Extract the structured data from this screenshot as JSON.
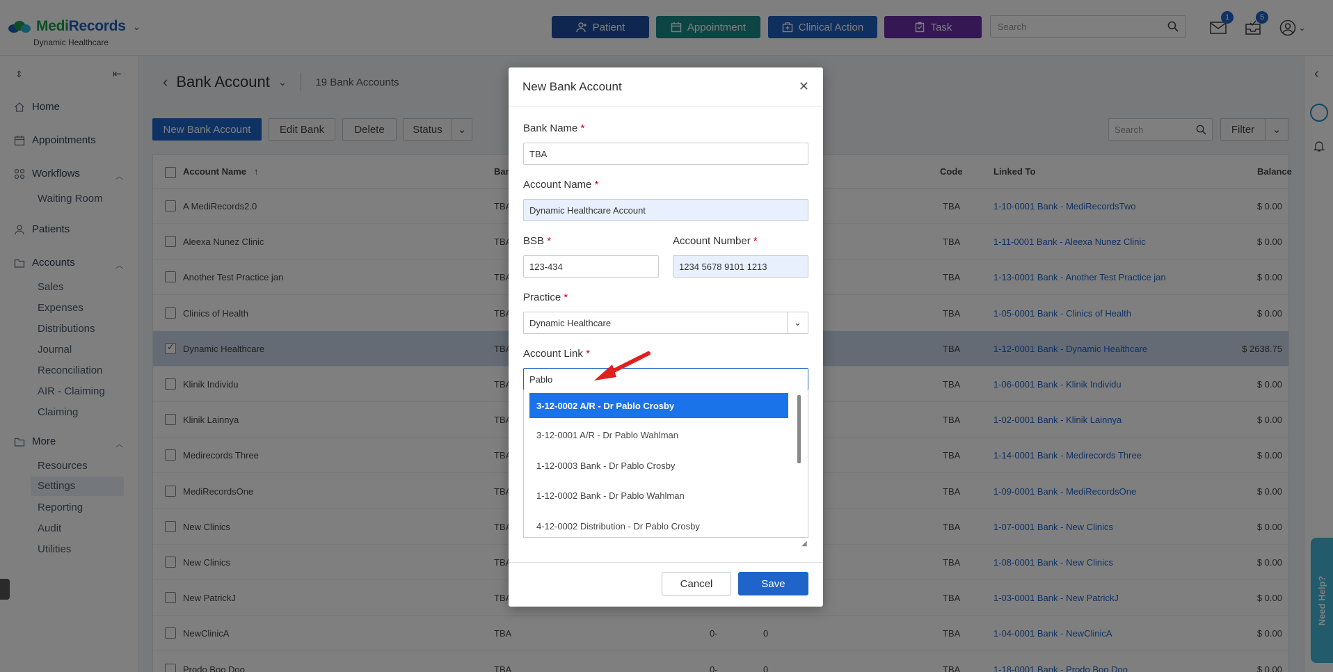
{
  "header": {
    "logo_a": "Medi",
    "logo_b": "Records",
    "practice": "Dynamic Healthcare",
    "actions": [
      {
        "label": "Patient",
        "color": "#1f4fa0"
      },
      {
        "label": "Appointment",
        "color": "#1a8a8a"
      },
      {
        "label": "Clinical Action",
        "color": "#1f5fbf"
      },
      {
        "label": "Task",
        "color": "#6a2fa8"
      }
    ],
    "search_placeholder": "Search",
    "mail_count": "1",
    "tasks_count": "5"
  },
  "sidebar": {
    "items": [
      {
        "label": "Home"
      },
      {
        "label": "Appointments"
      },
      {
        "label": "Workflows"
      },
      {
        "label": "Patients"
      },
      {
        "label": "Accounts"
      },
      {
        "label": "More"
      }
    ],
    "workflows_sub": [
      "Waiting Room"
    ],
    "accounts_sub": [
      "Sales",
      "Expenses",
      "Distributions",
      "Journal",
      "Reconciliation",
      "AIR - Claiming",
      "Claiming"
    ],
    "more_sub": [
      "Resources",
      "Settings",
      "Reporting",
      "Audit",
      "Utilities"
    ]
  },
  "page": {
    "title": "Bank Account",
    "count": "19 Bank Accounts",
    "toolbar": {
      "new": "New Bank Account",
      "edit": "Edit Bank",
      "delete": "Delete",
      "status": "Status",
      "search_placeholder": "Search",
      "filter": "Filter"
    },
    "columns": {
      "account_name": "Account Name",
      "bank": "Ban",
      "code": "Code",
      "linked_to": "Linked To",
      "balance": "Balance"
    },
    "rows": [
      {
        "name": "A MediRecords2.0",
        "bank": "TBA",
        "code": "TBA",
        "linked": "1-10-0001 Bank - MediRecordsTwo",
        "balance": "$ 0.00"
      },
      {
        "name": "Aleexa Nunez Clinic",
        "bank": "TBA",
        "code": "TBA",
        "linked": "1-11-0001 Bank - Aleexa Nunez Clinic",
        "balance": "$ 0.00"
      },
      {
        "name": "Another Test Practice jan",
        "bank": "TBA",
        "code": "TBA",
        "linked": "1-13-0001 Bank - Another Test Practice jan",
        "balance": "$ 0.00"
      },
      {
        "name": "Clinics of Health",
        "bank": "TBA",
        "code": "TBA",
        "linked": "1-05-0001 Bank - Clinics of Health",
        "balance": "$ 0.00"
      },
      {
        "name": "Dynamic Healthcare",
        "bank": "TBA",
        "code": "TBA",
        "linked": "1-12-0001 Bank - Dynamic Healthcare",
        "balance": "$ 2638.75"
      },
      {
        "name": "Klinik Individu",
        "bank": "TBA",
        "code": "TBA",
        "linked": "1-06-0001 Bank - Klinik Individu",
        "balance": "$ 0.00"
      },
      {
        "name": "Klinik Lainnya",
        "bank": "TBA",
        "code": "TBA",
        "linked": "1-02-0001 Bank - Klinik Lainnya",
        "balance": "$ 0.00"
      },
      {
        "name": "Medirecords Three",
        "bank": "TBA",
        "code": "TBA",
        "linked": "1-14-0001 Bank - Medirecords Three",
        "balance": "$ 0.00"
      },
      {
        "name": "MediRecordsOne",
        "bank": "TBA",
        "code": "TBA",
        "linked": "1-09-0001 Bank - MediRecordsOne",
        "balance": "$ 0.00"
      },
      {
        "name": "New Clinics",
        "bank": "TBA",
        "code": "TBA",
        "linked": "1-07-0001 Bank - New Clinics",
        "balance": "$ 0.00"
      },
      {
        "name": "New Clinics",
        "bank": "TBA",
        "code": "TBA",
        "linked": "1-08-0001 Bank - New Clinics",
        "balance": "$ 0.00"
      },
      {
        "name": "New PatrickJ",
        "bank": "TBA",
        "code": "TBA",
        "linked": "1-03-0001 Bank - New PatrickJ",
        "balance": "$ 0.00"
      },
      {
        "name": "NewClinicA",
        "bank": "TBA",
        "bsb": "0-",
        "acct": "0",
        "code": "TBA",
        "linked": "1-04-0001 Bank - NewClinicA",
        "balance": "$ 0.00"
      },
      {
        "name": "Prodo Boo Doo",
        "bank": "TBA",
        "bsb": "0-",
        "acct": "0",
        "code": "TBA",
        "linked": "1-18-0001 Bank - Prodo Boo Doo",
        "balance": "$ 0.00"
      }
    ]
  },
  "modal": {
    "title": "New Bank Account",
    "bank_name_label": "Bank Name",
    "bank_name_value": "TBA",
    "account_name_label": "Account Name",
    "account_name_value": "Dynamic Healthcare Account",
    "bsb_label": "BSB",
    "bsb_value": "123-434",
    "account_number_label": "Account Number",
    "account_number_value": "1234 5678 9101 1213",
    "practice_label": "Practice",
    "practice_value": "Dynamic Healthcare",
    "account_link_label": "Account Link",
    "account_link_value": "Pablo",
    "options": [
      "3-12-0002 A/R - Dr Pablo Crosby",
      "3-12-0001 A/R - Dr Pablo Wahlman",
      "1-12-0003 Bank - Dr Pablo Crosby",
      "1-12-0002 Bank - Dr Pablo Wahlman",
      "4-12-0002 Distribution - Dr Pablo Crosby"
    ],
    "cancel": "Cancel",
    "save": "Save"
  },
  "help": {
    "label": "Need Help?"
  },
  "colors": {
    "primary": "#1f64c8",
    "highlight": "#1a73e8",
    "required": "#d0021b",
    "arrow": "#e02020"
  }
}
